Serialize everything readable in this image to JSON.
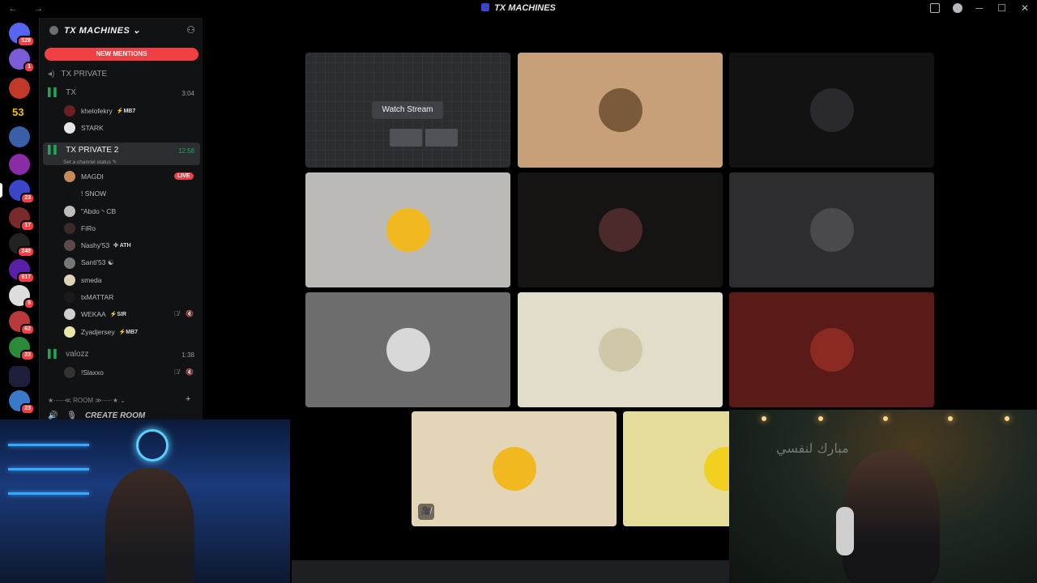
{
  "titlebar": {
    "title": "TX MACHINES",
    "nav_label": "← →",
    "win_controls": [
      "─",
      "☐",
      "✕"
    ]
  },
  "rail": {
    "servers": [
      {
        "name": "discord-home",
        "color": "#5865f2",
        "badge": "528"
      },
      {
        "name": "server-avatar",
        "color": "#7b5bd6",
        "badge": "1"
      },
      {
        "name": "server-arc",
        "color": "#c0392b",
        "badge": ""
      },
      {
        "name": "server-53",
        "color": "#000000",
        "badge": "",
        "label": "53"
      },
      {
        "name": "server-gang",
        "color": "#3a5ea8",
        "badge": ""
      },
      {
        "name": "server-neon",
        "color": "#8a2ca8",
        "badge": ""
      },
      {
        "name": "server-tx",
        "color": "#3b45c8",
        "badge": "23"
      },
      {
        "name": "server-red",
        "color": "#7a2a2a",
        "badge": "17"
      },
      {
        "name": "server-at",
        "color": "#222",
        "badge": "248"
      },
      {
        "name": "server-purple",
        "color": "#5a1fa8",
        "badge": "917"
      },
      {
        "name": "server-c",
        "color": "#ddd",
        "badge": "5"
      },
      {
        "name": "server-anime",
        "color": "#b83a3a",
        "badge": "62"
      },
      {
        "name": "server-green",
        "color": "#2a8a3a",
        "badge": "23"
      },
      {
        "name": "server-folder",
        "color": "#1e1f3a",
        "badge": ""
      },
      {
        "name": "server-blue",
        "color": "#3a78c8",
        "badge": "23"
      }
    ]
  },
  "sidebar": {
    "guild_name": "TX MACHINES",
    "guild_chevron": "⌄",
    "new_mentions": "NEW MENTIONS",
    "channels": {
      "tx_private": "TX PRIVATE",
      "tx": "TX",
      "tx_time": "3:04",
      "tx_private_2": "TX PRIVATE 2",
      "tx_private_2_time": "12:58",
      "status_placeholder": "Set a channel status ✎",
      "valozz": "valozz",
      "valozz_time": "1:38"
    },
    "tx_users": [
      {
        "name": "khelofekry",
        "tag": "⚡MB7",
        "color": "#6a1f24"
      },
      {
        "name": "STARK",
        "tag": "",
        "color": "#e6e6e6"
      }
    ],
    "tx2_users": [
      {
        "name": "MAGDI",
        "tag": "",
        "color": "#c58a5a"
      },
      {
        "name": "! SNOW",
        "tag": "",
        "color": "#111"
      },
      {
        "name": "\"Abdo丶CB",
        "tag": "",
        "color": "#bcbcbc"
      },
      {
        "name": "FiRo",
        "tag": "",
        "color": "#3a2a2a"
      },
      {
        "name": "Nashy'53",
        "tag": "✣ ATH",
        "color": "#5a4a4a"
      },
      {
        "name": "Santi'53 ☯",
        "tag": "",
        "color": "#777"
      },
      {
        "name": "smeda",
        "tag": "",
        "color": "#ddd4b8"
      },
      {
        "name": "txMATTAR",
        "tag": "",
        "color": "#1a1a1a"
      },
      {
        "name": "WEKAA",
        "tag": "⚡SIR",
        "color": "#cfcfcf"
      },
      {
        "name": "Zyadjersey",
        "tag": "⚡MB7",
        "color": "#e8e8a8"
      }
    ],
    "live_label": "LIVE",
    "valozz_users": [
      {
        "name": "!Slaxxo",
        "tag": "",
        "color": "#333"
      }
    ],
    "mute_icons": "🎙̸ 🔇",
    "room_category": "★·-·-·≪ ROOM ≫·-·-·★ ⌄",
    "room_add": "+",
    "create_room": "CREATE ROOM",
    "create_room_icons": "🔊 🎙"
  },
  "main": {
    "watch_stream": "Watch Stream",
    "tiles": [
      {
        "name": "tile-stream",
        "bg": "#2c2d31",
        "avatar": ""
      },
      {
        "name": "tile-khelofekry",
        "bg": "#c7a07a",
        "avatar": "#7a5a3a"
      },
      {
        "name": "tile-snow",
        "bg": "#121212",
        "avatar": "#2a2a2e"
      },
      {
        "name": "tile-stark",
        "bg": "#bcbab6",
        "avatar": "#f2b820"
      },
      {
        "name": "tile-firo",
        "bg": "#161413",
        "avatar": "#4a2a2a"
      },
      {
        "name": "tile-abdo",
        "bg": "#2d2d2f",
        "avatar": "#4a4a4e"
      },
      {
        "name": "tile-santi",
        "bg": "#6d6d6d",
        "avatar": "#d8d8d8"
      },
      {
        "name": "tile-smeda",
        "bg": "#e2dccb",
        "avatar": "#d0c7a8"
      },
      {
        "name": "tile-red",
        "bg": "#5a1a18",
        "avatar": "#8a2a22"
      },
      {
        "name": "tile-wekaa",
        "bg": "#e2d5b8",
        "avatar": "#f2b820"
      },
      {
        "name": "tile-zyad",
        "bg": "#e6dc9a",
        "avatar": "#f2d020"
      }
    ],
    "camera_off_icon": "🎥̸"
  },
  "webcams": {
    "right_wall_text": "مبارك لنفسي"
  }
}
